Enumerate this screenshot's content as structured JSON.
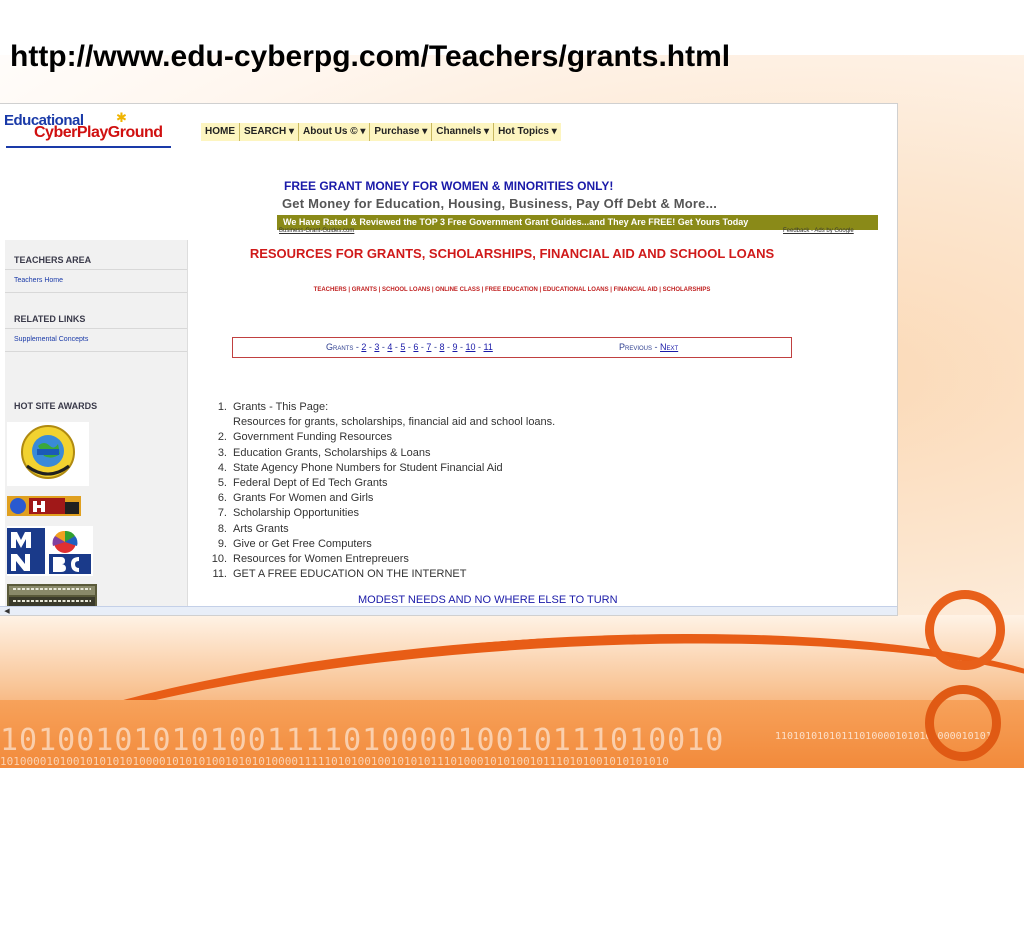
{
  "slide": {
    "title": "http://www.edu-cyberpg.com/Teachers/grants.html",
    "binary_large": "10100101010100111101000010010111010010",
    "binary_small": "1101010101011101000010101010000101010",
    "binary_bottom": "10100001010010101010100001010101001010101000011111010100100101010111010001010100101110101001010101010"
  },
  "site": {
    "logo_top": "Educational",
    "logo_bottom": "CyberPlayGround",
    "nav": [
      "HOME",
      "SEARCH ▾",
      "About Us © ▾",
      "Purchase ▾",
      "Channels ▾",
      "Hot Topics ▾"
    ],
    "ad": {
      "headline": "FREE GRANT MONEY FOR WOMEN & MINORITIES ONLY!",
      "subhead": "Get Money for Education, Housing, Business, Pay Off Debt & More...",
      "bar": "We Have Rated & Reviewed the TOP 3 Free Government Grant Guides...and They Are FREE!  Get Yours Today",
      "source": "Business-Grant-Guides.com",
      "feedback": "Feedback - Ads by Google"
    },
    "sidebar": {
      "teachers_area": "TEACHERS AREA",
      "teachers_home": "Teachers Home",
      "related_links": "RELATED LINKS",
      "supplemental": "Supplemental Concepts",
      "hot_site_awards": "HOT SITE AWARDS"
    },
    "main_title": "RESOURCES FOR GRANTS, SCHOLARSHIPS, FINANCIAL AID AND SCHOOL LOANS",
    "subnav": "TEACHERS | GRANTS | SCHOOL LOANS | ONLINE CLASS | FREE EDUCATION | EDUCATIONAL LOANS | FINANCIAL AID | SCHOLARSHIPS",
    "pager": {
      "label": "Grants",
      "pages": [
        "2",
        "3",
        "4",
        "5",
        "6",
        "7",
        "8",
        "9",
        "10",
        "11"
      ],
      "previous": "Previous",
      "next": "Next"
    },
    "list": [
      {
        "num": "1.",
        "text": "Grants - This Page:"
      },
      {
        "num": "",
        "text": "Resources for grants, scholarships, financial aid and school loans."
      },
      {
        "num": "2.",
        "text": "Government Funding Resources"
      },
      {
        "num": "3.",
        "text": "Education Grants, Scholarships & Loans"
      },
      {
        "num": "4.",
        "text": "State Agency Phone Numbers for Student Financial Aid"
      },
      {
        "num": "5.",
        "text": "Federal Dept of Ed Tech Grants"
      },
      {
        "num": "6.",
        "text": "Grants For Women and Girls"
      },
      {
        "num": "7.",
        "text": "Scholarship Opportunities"
      },
      {
        "num": "8.",
        "text": "Arts Grants"
      },
      {
        "num": "9.",
        "text": "Give or Get Free Computers"
      },
      {
        "num": "10.",
        "text": "Resources for Women Entrepreuers"
      },
      {
        "num": "11.",
        "text": "GET A FREE EDUCATION ON THE INTERNET"
      }
    ],
    "modest": "MODEST NEEDS AND NO WHERE ELSE TO TURN"
  }
}
